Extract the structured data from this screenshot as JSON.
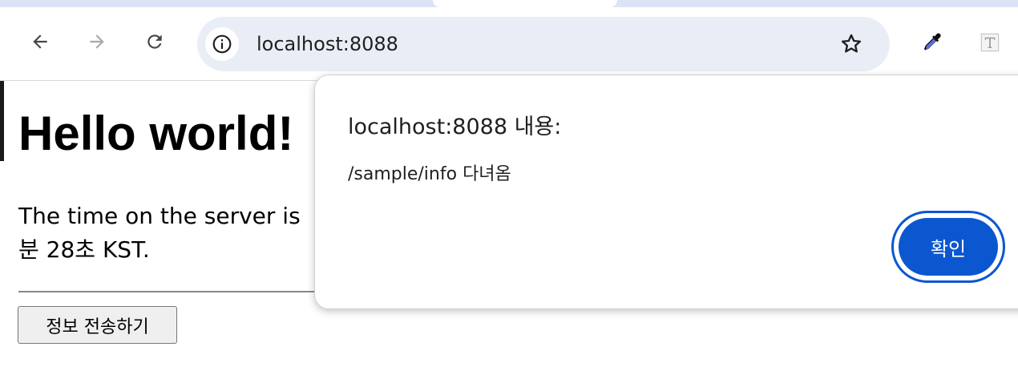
{
  "browser": {
    "url": "localhost:8088",
    "icons": {
      "back": "arrow-left-icon",
      "forward": "arrow-right-icon",
      "reload": "reload-icon",
      "site_info": "info-icon",
      "bookmark": "star-icon",
      "extension_1": "eyedropper-icon",
      "extension_2": "text-t-icon"
    }
  },
  "page": {
    "title": "Hello world!",
    "server_time_text": "The time on the server is\n분 28초 KST.",
    "send_button_label": "정보 전송하기"
  },
  "dialog": {
    "title": "localhost:8088 내용:",
    "message": "/sample/info 다녀옴",
    "ok_label": "확인",
    "accent_color": "#0b57d0"
  }
}
